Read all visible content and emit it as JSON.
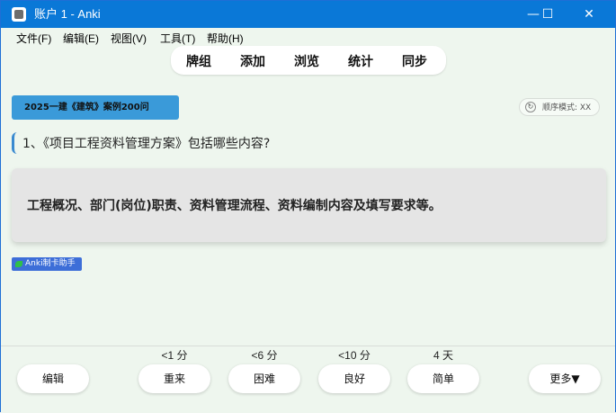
{
  "window": {
    "title": "账户 1 - Anki"
  },
  "menu": [
    "文件(F)",
    "编辑(E)",
    "视图(V)",
    "工具(T)",
    "帮助(H)"
  ],
  "toolbar": [
    "牌组",
    "添加",
    "浏览",
    "统计",
    "同步"
  ],
  "deck_tag": "2025一建《建筑》案例200问",
  "mode_label": "顺序模式: XX",
  "question": "1、《项目工程资料管理方案》包括哪些内容?",
  "answer": "工程概况、部门(岗位)职责、资料管理流程、资料编制内容及填写要求等。",
  "helper_badge": "Anki制卡助手",
  "intervals": [
    "<1 分",
    "<6 分",
    "<10 分",
    "4 天"
  ],
  "buttons": {
    "edit": "编辑",
    "again": "重来",
    "hard": "困难",
    "good": "良好",
    "easy": "简单",
    "more": "更多▼"
  },
  "window_controls": {
    "minimize": "—",
    "maximize": "☐",
    "close": "✕"
  }
}
